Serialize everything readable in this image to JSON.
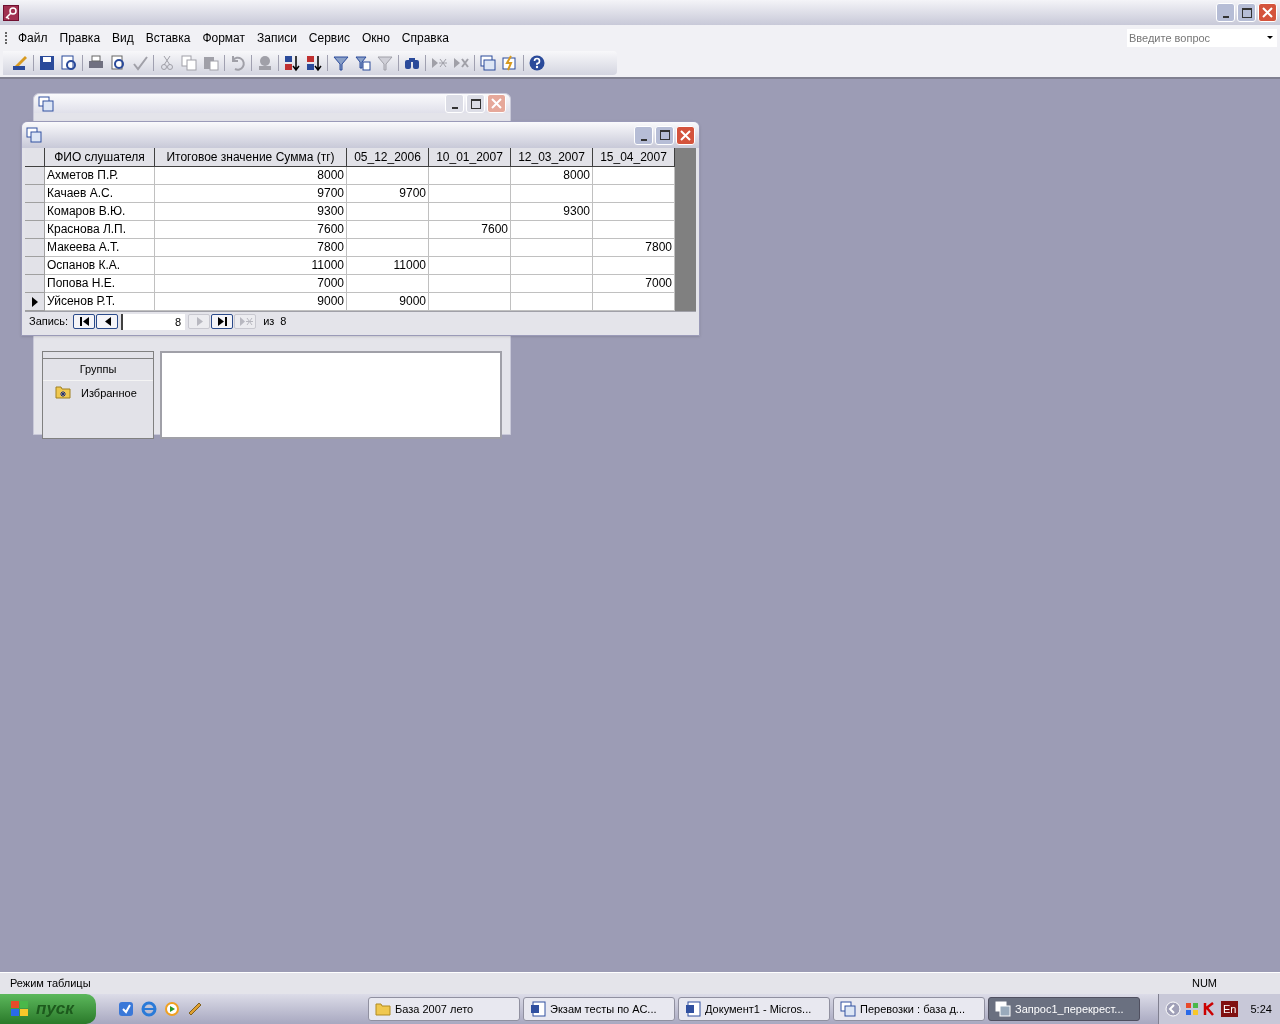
{
  "menu": [
    {
      "label": "Файл"
    },
    {
      "label": "Правка"
    },
    {
      "label": "Вид"
    },
    {
      "label": "Вставка"
    },
    {
      "label": "Формат"
    },
    {
      "label": "Записи"
    },
    {
      "label": "Сервис"
    },
    {
      "label": "Окно"
    },
    {
      "label": "Справка"
    }
  ],
  "help_search": {
    "placeholder": "Введите вопрос"
  },
  "toolbar": [
    {
      "kind": "view",
      "disabled": false
    },
    {
      "kind": "sep"
    },
    {
      "kind": "save",
      "disabled": false
    },
    {
      "kind": "search",
      "disabled": false
    },
    {
      "kind": "sep"
    },
    {
      "kind": "print",
      "disabled": false
    },
    {
      "kind": "preview",
      "disabled": false
    },
    {
      "kind": "spell",
      "disabled": true
    },
    {
      "kind": "sep"
    },
    {
      "kind": "cut",
      "disabled": true
    },
    {
      "kind": "copy",
      "disabled": true
    },
    {
      "kind": "paste",
      "disabled": true
    },
    {
      "kind": "sep"
    },
    {
      "kind": "undo",
      "disabled": true
    },
    {
      "kind": "sep"
    },
    {
      "kind": "link",
      "disabled": true
    },
    {
      "kind": "sep"
    },
    {
      "kind": "sortasc",
      "disabled": false
    },
    {
      "kind": "sortdesc",
      "disabled": false
    },
    {
      "kind": "sep"
    },
    {
      "kind": "filter",
      "disabled": false
    },
    {
      "kind": "filterform",
      "disabled": false
    },
    {
      "kind": "filter",
      "disabled": true
    },
    {
      "kind": "sep"
    },
    {
      "kind": "find",
      "disabled": false
    },
    {
      "kind": "sep"
    },
    {
      "kind": "newrec",
      "disabled": true
    },
    {
      "kind": "delrec",
      "disabled": true
    },
    {
      "kind": "sep"
    },
    {
      "kind": "dbwindow",
      "disabled": false
    },
    {
      "kind": "newobj",
      "disabled": false
    },
    {
      "kind": "sep"
    },
    {
      "kind": "help",
      "disabled": false
    }
  ],
  "db_window": {
    "groups_label": "Группы",
    "items": [
      {
        "label": "Избранное"
      }
    ]
  },
  "datasheet": {
    "columns": [
      "ФИО слушателя",
      "Итоговое значение Сумма (тг)",
      "05_12_2006",
      "10_01_2007",
      "12_03_2007",
      "15_04_2007"
    ],
    "rows": [
      {
        "selected": false,
        "cells": [
          "Ахметов П.Р.",
          "8000",
          "",
          "",
          "8000",
          ""
        ]
      },
      {
        "selected": false,
        "cells": [
          "Качаев А.С.",
          "9700",
          "9700",
          "",
          "",
          ""
        ]
      },
      {
        "selected": false,
        "cells": [
          "Комаров В.Ю.",
          "9300",
          "",
          "",
          "9300",
          ""
        ]
      },
      {
        "selected": false,
        "cells": [
          "Краснова Л.П.",
          "7600",
          "",
          "7600",
          "",
          ""
        ]
      },
      {
        "selected": false,
        "cells": [
          "Макеева А.Т.",
          "7800",
          "",
          "",
          "",
          "7800"
        ]
      },
      {
        "selected": false,
        "cells": [
          "Оспанов К.А.",
          "11000",
          "11000",
          "",
          "",
          ""
        ]
      },
      {
        "selected": false,
        "cells": [
          "Попова Н.Е.",
          "7000",
          "",
          "",
          "",
          "7000"
        ]
      },
      {
        "selected": true,
        "cells": [
          "Уйсенов Р.Т.",
          "9000",
          "9000",
          "",
          "",
          ""
        ]
      }
    ],
    "nav": {
      "label": "Запись:",
      "value": "8",
      "of_label": "из",
      "total": "8",
      "buttons": [
        {
          "kind": "first",
          "disabled": false
        },
        {
          "kind": "prev",
          "disabled": false
        },
        {
          "kind": "next",
          "disabled": true
        },
        {
          "kind": "last",
          "disabled": false
        },
        {
          "kind": "new",
          "disabled": true
        }
      ]
    }
  },
  "status_bar": {
    "text": "Режим таблицы",
    "indicator": "NUM"
  },
  "taskbar": {
    "start": "пуск",
    "quick_launch": [
      {
        "kind": "app"
      },
      {
        "kind": "ie"
      },
      {
        "kind": "player"
      },
      {
        "kind": "tool"
      }
    ],
    "tasks": [
      {
        "kind": "folder",
        "label": "База 2007 лето",
        "selected": false
      },
      {
        "kind": "word",
        "label": "Экзам тесты по АС...",
        "selected": false
      },
      {
        "kind": "word",
        "label": "Документ1 - Micros...",
        "selected": false
      },
      {
        "kind": "db",
        "label": "Перевозки : база д...",
        "selected": false
      },
      {
        "kind": "query",
        "label": "Запрос1_перекрест...",
        "selected": true
      }
    ],
    "language": "En",
    "clock": "5:24"
  }
}
